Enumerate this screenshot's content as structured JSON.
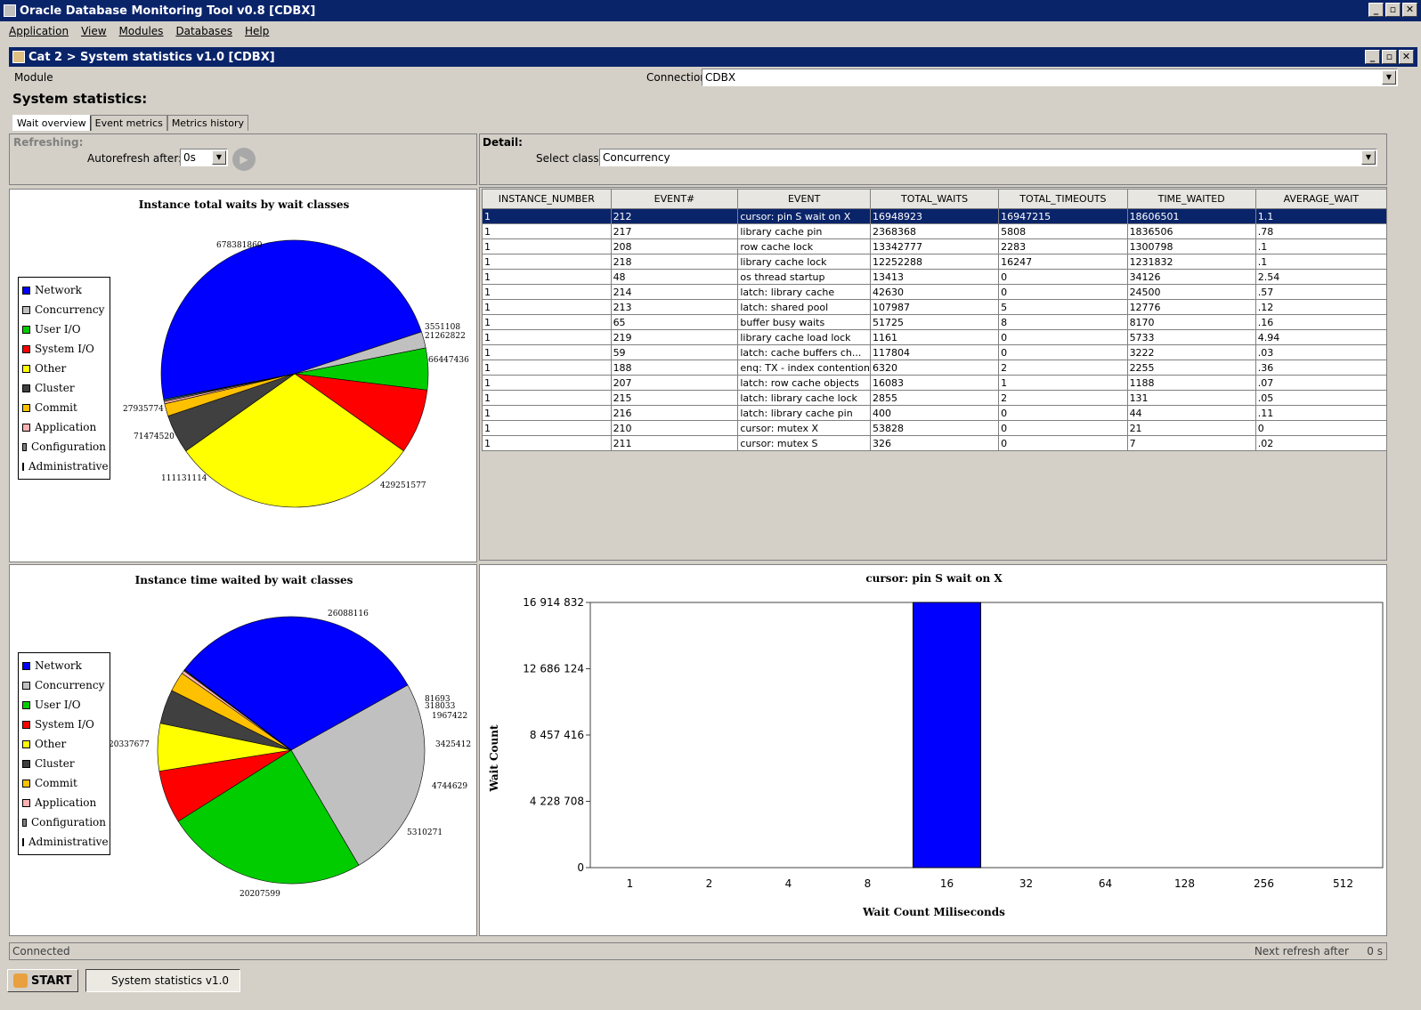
{
  "window": {
    "title": "Oracle Database Monitoring Tool v0.8 [CDBX]"
  },
  "menu": [
    "Application",
    "View",
    "Modules",
    "Databases",
    "Help"
  ],
  "subwindow": {
    "title": "Cat 2 > System statistics v1.0 [CDBX]"
  },
  "module_label": "Module",
  "connections": {
    "label": "Connections:",
    "value": "CDBX"
  },
  "section_title": "System statistics:",
  "tabs": [
    "Wait overview",
    "Event metrics",
    "Metrics history"
  ],
  "refreshing": {
    "label": "Refreshing:",
    "autorefresh_label": "Autorefresh after:",
    "autorefresh_value": "0s"
  },
  "detail": {
    "label": "Detail:",
    "select_class_label": "Select class:",
    "select_class_value": "Concurrency"
  },
  "table": {
    "columns": [
      "INSTANCE_NUMBER",
      "EVENT#",
      "EVENT",
      "TOTAL_WAITS",
      "TOTAL_TIMEOUTS",
      "TIME_WAITED",
      "AVERAGE_WAIT"
    ],
    "rows": [
      [
        "1",
        "212",
        "cursor: pin S wait on X",
        "16948923",
        "16947215",
        "18606501",
        "1.1"
      ],
      [
        "1",
        "217",
        "library cache pin",
        "2368368",
        "5808",
        "1836506",
        ".78"
      ],
      [
        "1",
        "208",
        "row cache lock",
        "13342777",
        "2283",
        "1300798",
        ".1"
      ],
      [
        "1",
        "218",
        "library cache lock",
        "12252288",
        "16247",
        "1231832",
        ".1"
      ],
      [
        "1",
        "48",
        "os thread startup",
        "13413",
        "0",
        "34126",
        "2.54"
      ],
      [
        "1",
        "214",
        "latch: library cache",
        "42630",
        "0",
        "24500",
        ".57"
      ],
      [
        "1",
        "213",
        "latch: shared pool",
        "107987",
        "5",
        "12776",
        ".12"
      ],
      [
        "1",
        "65",
        "buffer busy waits",
        "51725",
        "8",
        "8170",
        ".16"
      ],
      [
        "1",
        "219",
        "library cache load lock",
        "1161",
        "0",
        "5733",
        "4.94"
      ],
      [
        "1",
        "59",
        "latch: cache buffers ch...",
        "117804",
        "0",
        "3222",
        ".03"
      ],
      [
        "1",
        "188",
        "enq: TX - index contention",
        "6320",
        "2",
        "2255",
        ".36"
      ],
      [
        "1",
        "207",
        "latch: row cache objects",
        "16083",
        "1",
        "1188",
        ".07"
      ],
      [
        "1",
        "215",
        "latch: library cache lock",
        "2855",
        "2",
        "131",
        ".05"
      ],
      [
        "1",
        "216",
        "latch: library cache pin",
        "400",
        "0",
        "44",
        ".11"
      ],
      [
        "1",
        "210",
        "cursor: mutex X",
        "53828",
        "0",
        "21",
        "0"
      ],
      [
        "1",
        "211",
        "cursor: mutex S",
        "326",
        "0",
        "7",
        ".02"
      ]
    ]
  },
  "legend": [
    {
      "name": "Network",
      "color": "#0000ff"
    },
    {
      "name": "Concurrency",
      "color": "#c0c0c0"
    },
    {
      "name": "User I/O",
      "color": "#00cc00"
    },
    {
      "name": "System I/O",
      "color": "#ff0000"
    },
    {
      "name": "Other",
      "color": "#ffff00"
    },
    {
      "name": "Cluster",
      "color": "#404040"
    },
    {
      "name": "Commit",
      "color": "#ffc000"
    },
    {
      "name": "Application",
      "color": "#ffb0b0"
    },
    {
      "name": "Configuration",
      "color": "#808080"
    },
    {
      "name": "Administrative",
      "color": "#00ccff"
    }
  ],
  "chart_data": [
    {
      "type": "pie",
      "title": "Instance total waits by wait classes",
      "slices": [
        {
          "label": "Network",
          "value": 678381860
        },
        {
          "label": "Concurrency",
          "value": 27935774
        },
        {
          "label": "User I/O",
          "value": 71474520
        },
        {
          "label": "System I/O",
          "value": 111131114
        },
        {
          "label": "Other",
          "value": 429251577
        },
        {
          "label": "Cluster",
          "value": 66447436
        },
        {
          "label": "Commit",
          "value": 21262822
        },
        {
          "label": "Application",
          "value": 3951108
        },
        {
          "label": "Configuration",
          "value": 2553193
        },
        {
          "label": "Administrative",
          "value": 1500000
        }
      ],
      "labels_shown": [
        "678381860",
        "27935774",
        "71474520",
        "111131114",
        "429251577",
        "66447436",
        "21262822",
        "3551108"
      ]
    },
    {
      "type": "pie",
      "title": "Instance time waited by wait classes",
      "slices": [
        {
          "label": "Network",
          "value": 26088116
        },
        {
          "label": "Concurrency",
          "value": 20337677
        },
        {
          "label": "User I/O",
          "value": 20207599
        },
        {
          "label": "System I/O",
          "value": 5310271
        },
        {
          "label": "Other",
          "value": 4744629
        },
        {
          "label": "Cluster",
          "value": 3425412
        },
        {
          "label": "Commit",
          "value": 1967422
        },
        {
          "label": "Application",
          "value": 318033
        },
        {
          "label": "Configuration",
          "value": 81693
        },
        {
          "label": "Administrative",
          "value": 20000
        }
      ],
      "labels_shown": [
        "26088116",
        "20337677",
        "20207599",
        "5310271",
        "4744629",
        "3425412",
        "1967422",
        "318033",
        "81693"
      ]
    },
    {
      "type": "bar",
      "title": "cursor: pin S wait on X",
      "xlabel": "Wait Count Miliseconds",
      "ylabel": "Wait Count",
      "categories": [
        "1",
        "2",
        "4",
        "8",
        "16",
        "32",
        "64",
        "128",
        "256",
        "512"
      ],
      "values": [
        0,
        0,
        0,
        0,
        16914832,
        0,
        0,
        0,
        0,
        0
      ],
      "yticks": [
        "0",
        "4 228 708",
        "8 457 416",
        "12 686 124",
        "16 914 832"
      ],
      "ylim": [
        0,
        16914832
      ],
      "bar_color": "#0000ff"
    }
  ],
  "status": {
    "left": "Connected",
    "right": "Next refresh after",
    "right_value": "0 s"
  },
  "taskbar": {
    "start": "START",
    "item": "System statistics v1.0"
  }
}
